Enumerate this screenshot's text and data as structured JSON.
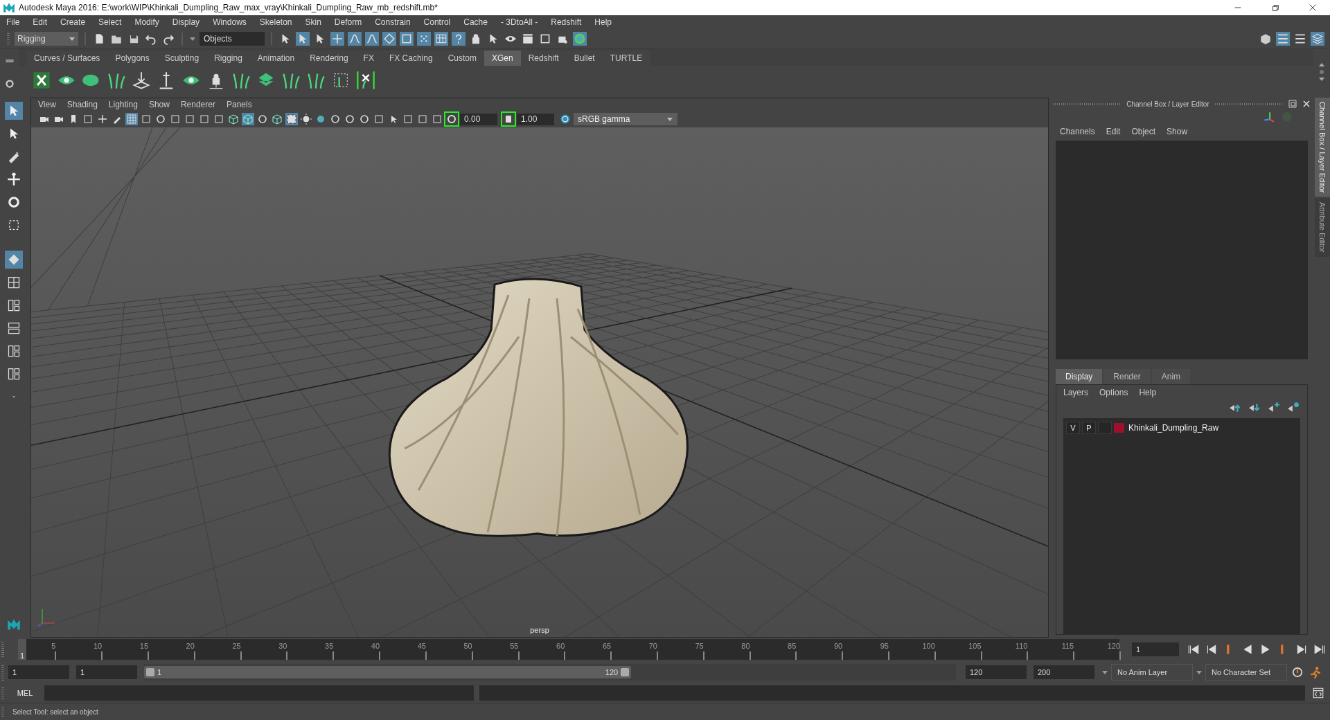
{
  "window": {
    "title": "Autodesk Maya 2016: E:\\work\\WIP\\Khinkali_Dumpling_Raw_max_vray\\Khinkali_Dumpling_Raw_mb_redshift.mb*"
  },
  "menu_bar": [
    "File",
    "Edit",
    "Create",
    "Select",
    "Modify",
    "Display",
    "Windows",
    "Skeleton",
    "Skin",
    "Deform",
    "Constrain",
    "Control",
    "Cache",
    "- 3DtoAll -",
    "Redshift",
    "Help"
  ],
  "toolbar": {
    "mode_select": "Rigging",
    "selection_field": "Objects"
  },
  "shelf_tabs": [
    {
      "label": "Curves / Surfaces",
      "selected": false
    },
    {
      "label": "Polygons",
      "selected": false
    },
    {
      "label": "Sculpting",
      "selected": false
    },
    {
      "label": "Rigging",
      "selected": false
    },
    {
      "label": "Animation",
      "selected": false
    },
    {
      "label": "Rendering",
      "selected": false
    },
    {
      "label": "FX",
      "selected": false
    },
    {
      "label": "FX Caching",
      "selected": false
    },
    {
      "label": "Custom",
      "selected": false
    },
    {
      "label": "XGen",
      "selected": true
    },
    {
      "label": "Redshift",
      "selected": false
    },
    {
      "label": "Bullet",
      "selected": false
    },
    {
      "label": "TURTLE",
      "selected": false
    }
  ],
  "viewport": {
    "menus": [
      "View",
      "Shading",
      "Lighting",
      "Show",
      "Renderer",
      "Panels"
    ],
    "exposure": "0.00",
    "gamma": "1.00",
    "color_space": "sRGB gamma",
    "camera_label": "persp"
  },
  "channel_box": {
    "title": "Channel Box / Layer Editor",
    "menus": [
      "Channels",
      "Edit",
      "Object",
      "Show"
    ]
  },
  "layer_editor": {
    "tabs": [
      {
        "label": "Display",
        "selected": true
      },
      {
        "label": "Render",
        "selected": false
      },
      {
        "label": "Anim",
        "selected": false
      }
    ],
    "menus": [
      "Layers",
      "Options",
      "Help"
    ],
    "layers": [
      {
        "visible": "V",
        "playback": "P",
        "color": "#a0102c",
        "name": "Khinkali_Dumpling_Raw"
      }
    ]
  },
  "side_tabs": [
    {
      "label": "Channel Box / Layer Editor",
      "selected": true
    },
    {
      "label": "Attribute Editor",
      "selected": false
    }
  ],
  "timeline": {
    "ticks": [
      "5",
      "10",
      "15",
      "20",
      "25",
      "30",
      "35",
      "40",
      "45",
      "50",
      "55",
      "60",
      "65",
      "70",
      "75",
      "80",
      "85",
      "90",
      "95",
      "100",
      "105",
      "110",
      "115",
      "120"
    ],
    "current_frame": "1",
    "level": 0,
    "frame_field": "1"
  },
  "range": {
    "start": "1",
    "playback_start": "1",
    "slider_start": "1",
    "slider_end": "120",
    "level": 0.6,
    "playback_end": "120",
    "end": "200",
    "anim_layer": "No Anim Layer",
    "character_set": "No Character Set"
  },
  "command_line": {
    "label": "MEL"
  },
  "status_bar": {
    "text": "Select Tool: select an object"
  }
}
